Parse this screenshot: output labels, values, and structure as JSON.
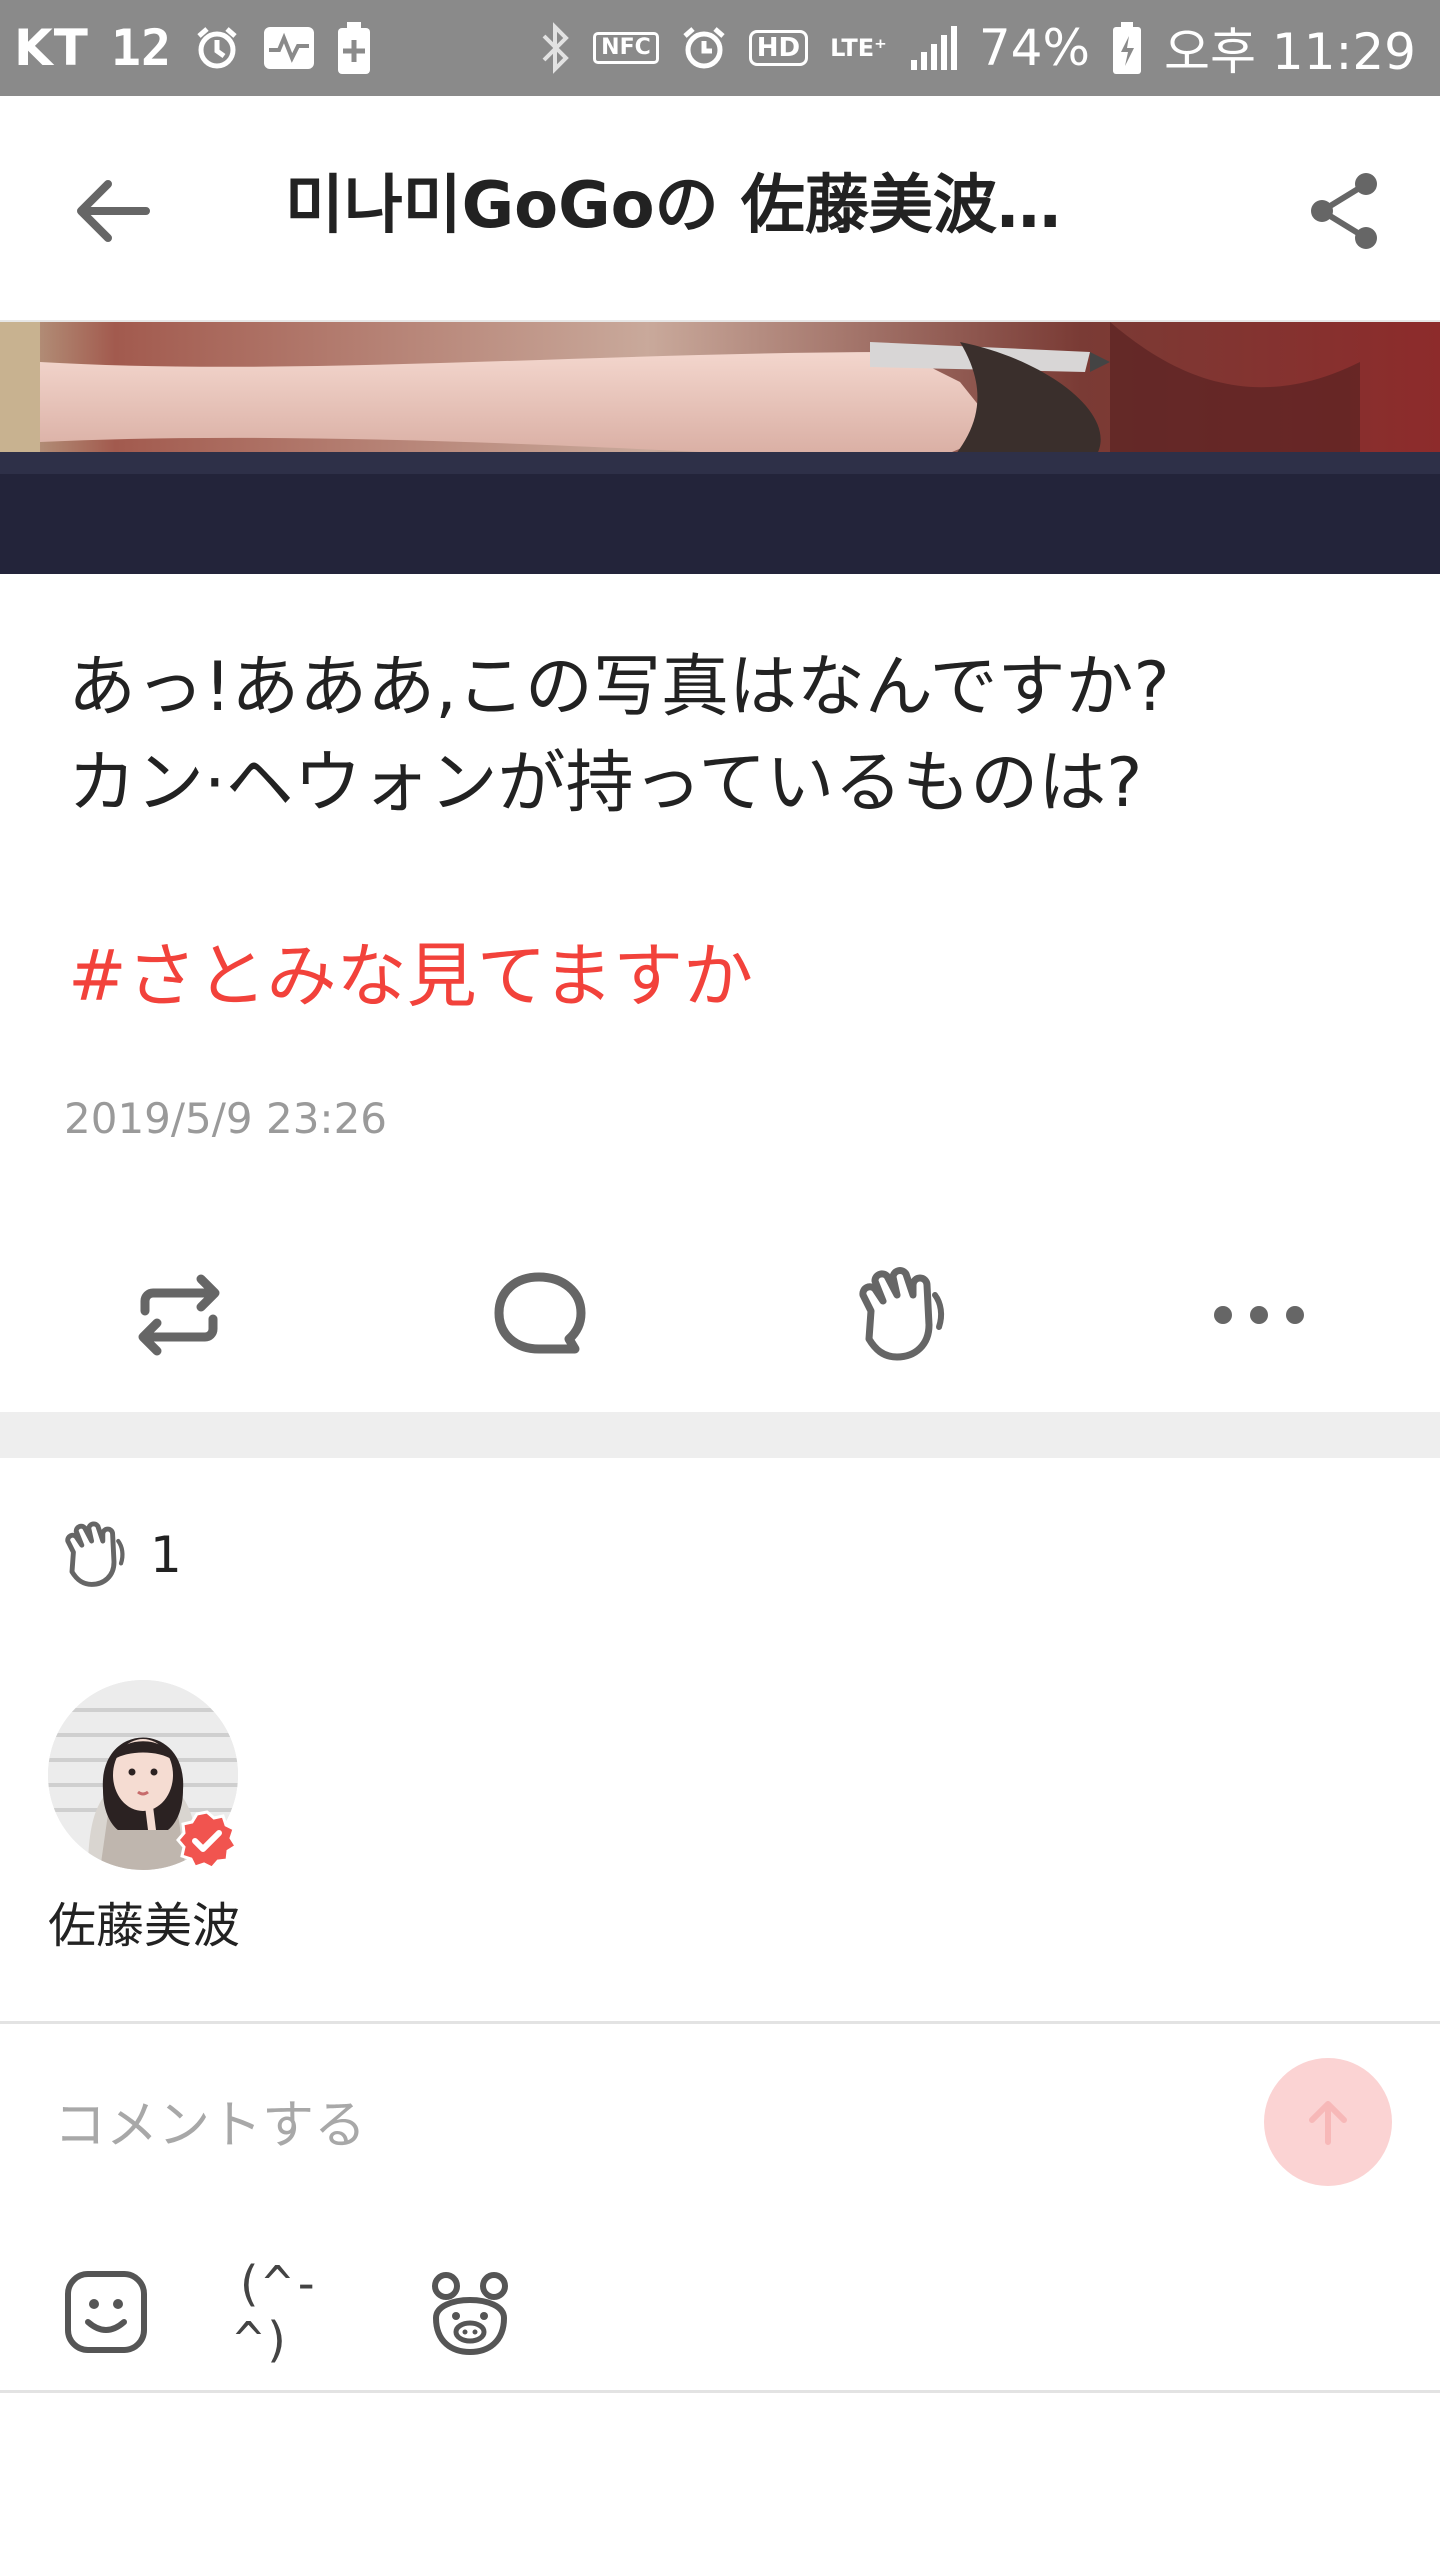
{
  "status_bar": {
    "carrier": "KT",
    "notification_count": "12",
    "nfc_label": "NFC",
    "hd_label": "HD",
    "lte_label": "LTE⁺",
    "battery_percent": "74%",
    "time": "오후 11:29"
  },
  "header": {
    "title": "미나미GoGoの 佐藤美波…",
    "back_icon": "arrow-left-icon",
    "share_icon": "share-icon"
  },
  "post": {
    "line1": "あっ!あああ,この写真はなんですか?",
    "line2": "カン·ヘウォンが持っているものは?",
    "hashtag": "#さとみな見てますか",
    "date": "2019/5/9 23:26"
  },
  "actions": {
    "icons": [
      "repost-icon",
      "comment-bubble-icon",
      "clap-hand-icon",
      "more-dots-icon"
    ]
  },
  "likes": {
    "count": "1",
    "users": [
      {
        "name": "佐藤美波",
        "verified": true
      }
    ]
  },
  "comment": {
    "placeholder": "コメントする",
    "kaomoji": "(^-^)"
  },
  "colors": {
    "accent_red": "#f2423b",
    "send_button_bg": "#fbd3d3",
    "status_bar_bg": "#8a8a8a"
  }
}
